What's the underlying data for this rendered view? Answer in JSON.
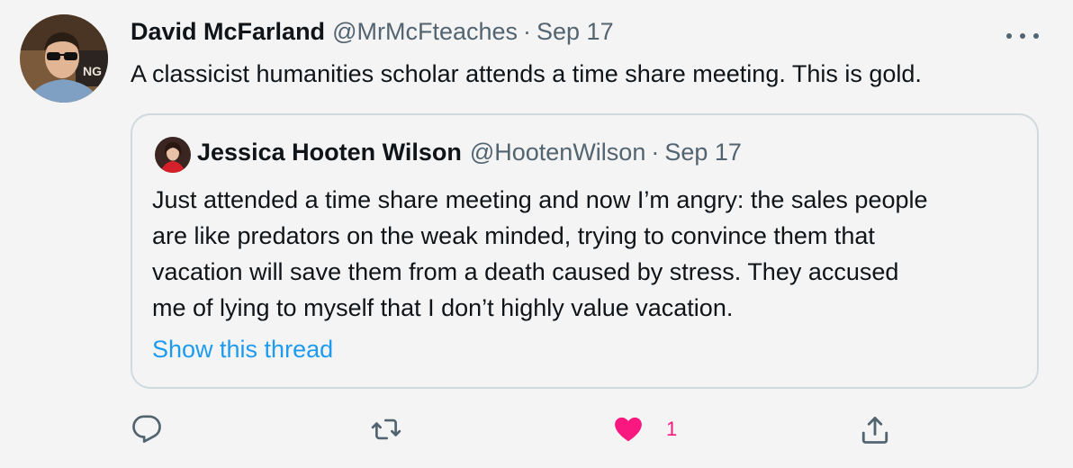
{
  "tweet": {
    "author_name": "David McFarland",
    "author_handle": "@MrMcFteaches",
    "separator": "·",
    "date": "Sep 17",
    "text": "A classicist humanities scholar attends a time share meeting. This is gold."
  },
  "quoted_tweet": {
    "author_name": "Jessica Hooten Wilson",
    "author_handle": "@HootenWilson",
    "separator": "·",
    "date": "Sep 17",
    "text_lines": [
      "Just attended a time share meeting and now I’m angry: the sales people",
      "are like predators on the weak minded, trying to convince them that",
      "vacation will save them from a death caused by stress. They accused",
      "me of lying to myself that I don’t highly value vacation."
    ],
    "show_thread": "Show this thread"
  },
  "actions": {
    "reply_icon": "reply-icon",
    "retweet_icon": "retweet-icon",
    "like_icon": "heart-filled-icon",
    "like_count": "1",
    "share_icon": "share-icon"
  },
  "colors": {
    "background": "#f4f4f4",
    "text": "#0f1419",
    "secondary": "#536471",
    "link": "#1d9bf0",
    "like": "#f91880",
    "border": "#cfd9de"
  }
}
